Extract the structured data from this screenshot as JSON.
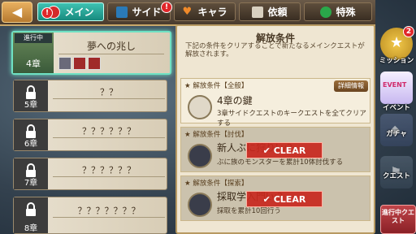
{
  "header": {
    "back_icon": "back-arrow-icon",
    "tabs": [
      {
        "label": "メイン",
        "icon": "main-quest-icon",
        "active": true,
        "badge": "!"
      },
      {
        "label": "サイド",
        "icon": "side-quest-icon",
        "active": false,
        "badge": "!"
      },
      {
        "label": "キャラ",
        "icon": "heart-icon",
        "active": false,
        "badge": ""
      },
      {
        "label": "依頼",
        "icon": "request-icon",
        "active": false,
        "badge": ""
      },
      {
        "label": "特殊",
        "icon": "special-icon",
        "active": false,
        "badge": ""
      }
    ]
  },
  "quests": [
    {
      "status": "進行中",
      "title": "夢への兆し",
      "chapter": "4章",
      "locked": false
    },
    {
      "title": "？？",
      "chapter": "5章",
      "locked": true
    },
    {
      "title": "？？？？？？",
      "chapter": "6章",
      "locked": true
    },
    {
      "title": "？？？？？？",
      "chapter": "7章",
      "locked": true
    },
    {
      "title": "？？？？？？？",
      "chapter": "8章",
      "locked": true
    }
  ],
  "panel": {
    "title": "解放条件",
    "description": "下記の条件をクリアすることで新たなるメインクエストが解放されます。",
    "conditions": [
      {
        "header": "解放条件【全般】",
        "name": "4章の鍵",
        "detail": "3章サイドクエストのキークエストを全てクリアする",
        "button": "詳細情報",
        "cleared": false
      },
      {
        "header": "解放条件【討伐】",
        "name": "新人ぶに狩りLv2",
        "detail": "ぶに族のモンスターを累計10体討伐する",
        "cleared": true,
        "stamp": "CLEAR"
      },
      {
        "header": "解放条件【探索】",
        "name": "採取学入門Lv2",
        "detail": "採取を累計10回行う",
        "cleared": true,
        "stamp": "CLEAR"
      }
    ]
  },
  "side_menu": [
    {
      "label": "ミッション",
      "icon": "medal-icon",
      "badge": "2"
    },
    {
      "label": "イベント",
      "icon": "event-icon",
      "badge": ""
    },
    {
      "label": "ガチャ",
      "icon": "gacha-icon",
      "badge": ""
    },
    {
      "label": "クエスト",
      "icon": "quest-icon",
      "badge": ""
    },
    {
      "label": "進行中クエスト",
      "icon": "ongoing-quest-icon",
      "badge": ""
    }
  ],
  "colors": {
    "accent": "#2fb5a5",
    "clear_red": "#c8281e",
    "panel_bg": "#efe6d2"
  }
}
